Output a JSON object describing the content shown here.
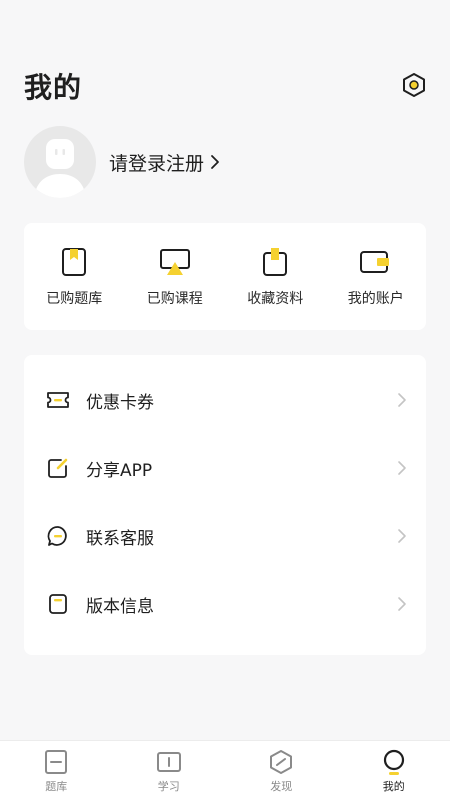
{
  "header": {
    "title": "我的",
    "settings_icon": "settings-hexagon-icon"
  },
  "profile": {
    "avatar_icon": "default-avatar-icon",
    "login_text": "请登录注册"
  },
  "quick_links": [
    {
      "label": "已购题库",
      "icon": "bookmark-icon"
    },
    {
      "label": "已购课程",
      "icon": "video-course-icon"
    },
    {
      "label": "收藏资料",
      "icon": "favorites-icon"
    },
    {
      "label": "我的账户",
      "icon": "wallet-icon"
    }
  ],
  "menu": [
    {
      "label": "优惠卡券",
      "icon": "coupon-icon"
    },
    {
      "label": "分享APP",
      "icon": "share-icon"
    },
    {
      "label": "联系客服",
      "icon": "chat-icon"
    },
    {
      "label": "版本信息",
      "icon": "info-icon"
    }
  ],
  "tabbar": {
    "active": "我的",
    "tabs": [
      {
        "label": "题库",
        "icon": "question-bank-icon"
      },
      {
        "label": "学习",
        "icon": "study-icon"
      },
      {
        "label": "发现",
        "icon": "discover-icon"
      },
      {
        "label": "我的",
        "icon": "profile-icon"
      }
    ]
  },
  "colors": {
    "accent": "#f5d130",
    "text": "#1f1f1f",
    "muted": "#8a8a8a",
    "background": "#f7f7f8"
  }
}
